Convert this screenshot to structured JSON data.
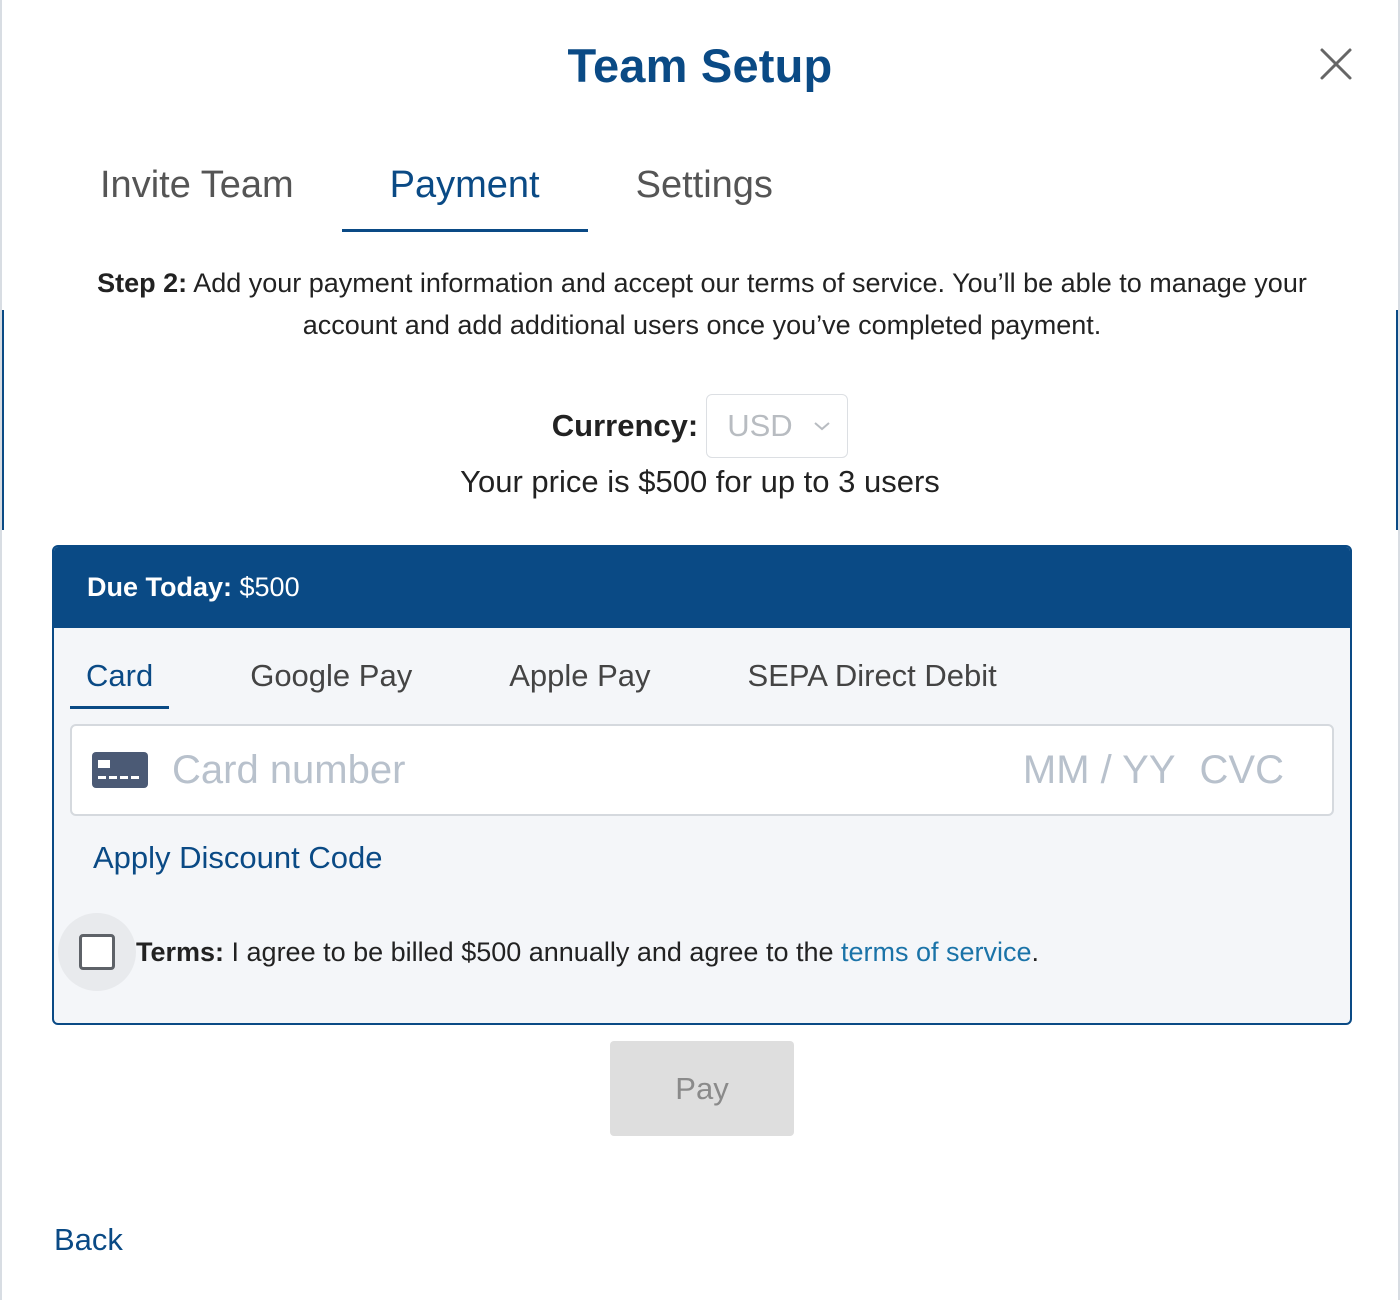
{
  "modal": {
    "title": "Team Setup",
    "close_icon": "close-icon"
  },
  "tabs": [
    {
      "label": "Invite Team",
      "active": false
    },
    {
      "label": "Payment",
      "active": true
    },
    {
      "label": "Settings",
      "active": false
    }
  ],
  "step": {
    "prefix": "Step 2:",
    "text": " Add your payment information and accept our terms of service. You’ll be able to manage your account and add additional users once you’ve completed payment."
  },
  "currency": {
    "label": "Currency:",
    "selected": "USD"
  },
  "price_text": "Your price is $500 for up to 3 users",
  "payment": {
    "due_label": "Due Today:",
    "due_amount": " $500",
    "methods": [
      {
        "label": "Card",
        "active": true
      },
      {
        "label": "Google Pay",
        "active": false
      },
      {
        "label": "Apple Pay",
        "active": false
      },
      {
        "label": "SEPA Direct Debit",
        "active": false
      }
    ],
    "card_number_placeholder": "Card number",
    "expiry_placeholder": "MM / YY",
    "cvc_placeholder": "CVC",
    "discount_link": "Apply Discount Code",
    "terms_label": "Terms:",
    "terms_text": " I agree to be billed $500 annually and agree to the ",
    "terms_link": "terms of service",
    "terms_suffix": ".",
    "terms_checked": false
  },
  "actions": {
    "pay_label": "Pay",
    "back_label": "Back"
  },
  "colors": {
    "primary": "#0a4a85",
    "link": "#1a73a8",
    "disabled_bg": "#dedede"
  }
}
